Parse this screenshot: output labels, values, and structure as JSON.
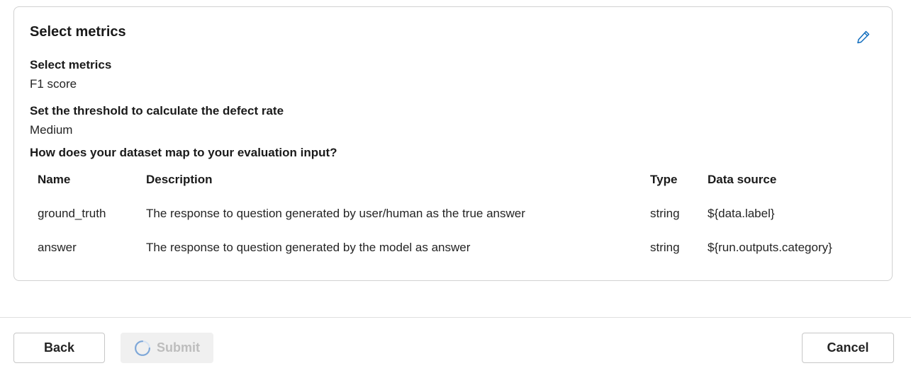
{
  "card": {
    "title": "Select metrics",
    "edit_icon": "pencil-icon"
  },
  "fields": {
    "metrics_label": "Select metrics",
    "metrics_value": "F1 score",
    "threshold_label": "Set the threshold to calculate the defect rate",
    "threshold_value": "Medium",
    "mapping_label": "How does your dataset map to your evaluation input?"
  },
  "table": {
    "headers": {
      "name": "Name",
      "description": "Description",
      "type": "Type",
      "data_source": "Data source"
    },
    "rows": [
      {
        "name": "ground_truth",
        "description": "The response to question generated by user/human as the true answer",
        "type": "string",
        "data_source": "${data.label}"
      },
      {
        "name": "answer",
        "description": "The response to question generated by the model as answer",
        "type": "string",
        "data_source": "${run.outputs.category}"
      }
    ]
  },
  "footer": {
    "back_label": "Back",
    "submit_label": "Submit",
    "cancel_label": "Cancel",
    "submit_icon": "spinner-icon"
  },
  "colors": {
    "accent": "#0f6cbd",
    "spinner": "#7ea7d8",
    "disabled_text": "#bdbdbd"
  }
}
